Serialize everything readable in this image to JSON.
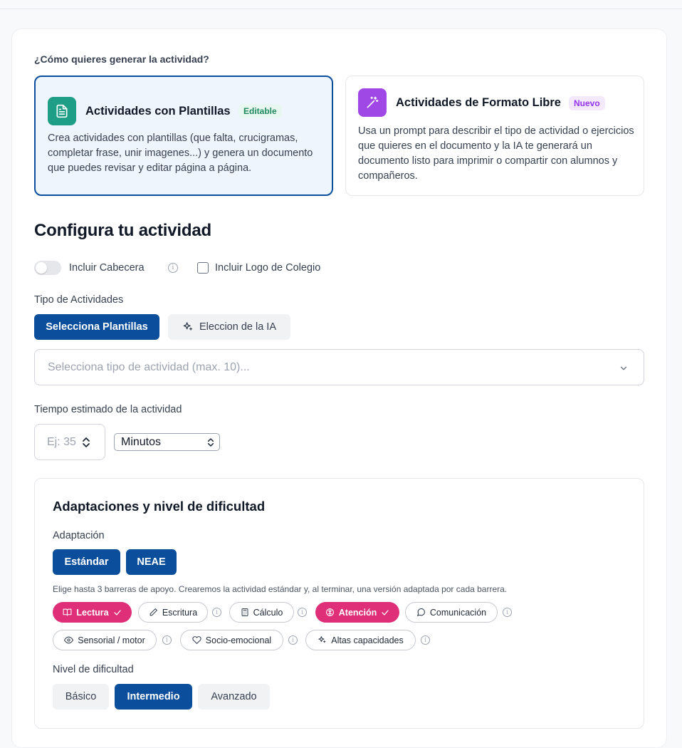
{
  "generation": {
    "question": "¿Cómo quieres generar la actividad?",
    "options": [
      {
        "title": "Actividades con Plantillas",
        "badge": "Editable",
        "description": "Crea actividades con plantillas (que falta, crucigramas, completar frase, unir imagenes...) y genera un documento que puedes revisar y editar página a página.",
        "selected": true,
        "icon": "document-icon",
        "icon_color": "#1e9e86"
      },
      {
        "title": "Actividades de Formato Libre",
        "badge": "Nuevo",
        "description": "Usa un prompt para describir el tipo de actividad o ejercicios que quieres en el documento y la IA te generará un documento listo para imprimir o compartir con alumnos y compañeros.",
        "selected": false,
        "icon": "magic-wand-icon",
        "icon_color": "#a048e6"
      }
    ]
  },
  "config": {
    "heading": "Configura tu actividad",
    "include_header_label": "Incluir Cabecera",
    "include_header_on": false,
    "include_logo_label": "Incluir Logo de Colegio",
    "include_logo_checked": false,
    "activity_type_label": "Tipo de Actividades",
    "type_buttons": {
      "templates": "Selecciona Plantillas",
      "ai_choice": "Eleccion de la IA"
    },
    "activity_select_placeholder": "Selecciona tipo de actividad (max. 10)...",
    "time_label": "Tiempo estimado de la actividad",
    "time_placeholder": "Ej: 35",
    "time_unit": "Minutos"
  },
  "adaptations": {
    "heading": "Adaptaciones y nivel de dificultad",
    "adaptation_label": "Adaptación",
    "adaptation_buttons": {
      "standard": "Estándar",
      "neae": "NEAE"
    },
    "helper": "Elige hasta 3 barreras de apoyo. Crearemos la actividad estándar y, al terminar, una versión adaptada por cada barrera.",
    "barriers": [
      {
        "label": "Lectura",
        "selected": true,
        "icon": "book-icon"
      },
      {
        "label": "Escritura",
        "selected": false,
        "icon": "pencil-icon"
      },
      {
        "label": "Cálculo",
        "selected": false,
        "icon": "calculator-icon"
      },
      {
        "label": "Atención",
        "selected": true,
        "icon": "brain-icon"
      },
      {
        "label": "Comunicación",
        "selected": false,
        "icon": "speech-bubble-icon"
      },
      {
        "label": "Sensorial / motor",
        "selected": false,
        "icon": "eye-icon"
      },
      {
        "label": "Socio-emocional",
        "selected": false,
        "icon": "heart-icon"
      },
      {
        "label": "Altas capacidades",
        "selected": false,
        "icon": "sparkles-icon"
      }
    ],
    "difficulty_label": "Nivel de dificultad",
    "difficulty_levels": {
      "basic": "Básico",
      "intermediate": "Intermedio",
      "advanced": "Avanzado"
    },
    "difficulty_selected": "Intermedio"
  },
  "colors": {
    "primary": "#0b4f9c",
    "accent_pink": "#de2f78",
    "badge_green": "#1e8a5e",
    "badge_purple": "#9333ea"
  }
}
